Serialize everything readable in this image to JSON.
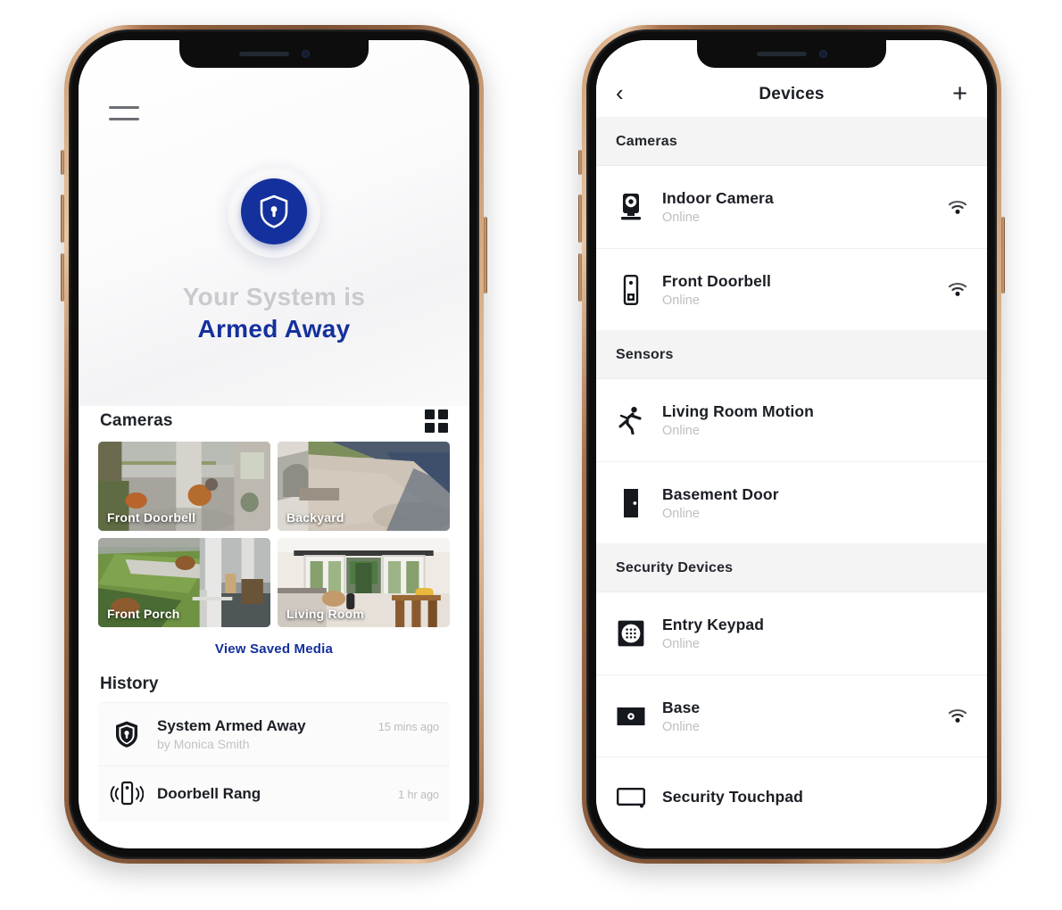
{
  "brand": {
    "accent": "#14309c",
    "muted": "#c9cacd",
    "dark": "#1b1e24"
  },
  "home": {
    "menu_icon": "hamburger-icon",
    "shield_icon": "shield-lock-icon",
    "status_prefix": "Your System is",
    "status_value": "Armed Away",
    "cameras": {
      "heading": "Cameras",
      "grid_icon": "grid-view-icon",
      "tiles": [
        {
          "label": "Front Doorbell"
        },
        {
          "label": "Backyard"
        },
        {
          "label": "Front Porch"
        },
        {
          "label": "Living Room"
        }
      ],
      "view_media_label": "View Saved Media"
    },
    "history": {
      "heading": "History",
      "items": [
        {
          "icon": "shield-lock-icon",
          "title": "System Armed Away",
          "time": "15 mins ago",
          "subtitle": "by Monica Smith"
        },
        {
          "icon": "doorbell-ring-icon",
          "title": "Doorbell Rang",
          "time": "1 hr ago",
          "subtitle": ""
        }
      ]
    }
  },
  "devices": {
    "back_icon": "chevron-left-icon",
    "title": "Devices",
    "add_icon": "plus-icon",
    "sections": [
      {
        "heading": "Cameras",
        "rows": [
          {
            "icon": "indoor-camera-icon",
            "name": "Indoor Camera",
            "status": "Online",
            "wifi": true
          },
          {
            "icon": "doorbell-icon",
            "name": "Front Doorbell",
            "status": "Online",
            "wifi": true
          }
        ]
      },
      {
        "heading": "Sensors",
        "rows": [
          {
            "icon": "motion-sensor-icon",
            "name": "Living Room Motion",
            "status": "Online",
            "wifi": false
          },
          {
            "icon": "door-sensor-icon",
            "name": "Basement Door",
            "status": "Online",
            "wifi": false
          }
        ]
      },
      {
        "heading": "Security Devices",
        "rows": [
          {
            "icon": "keypad-icon",
            "name": "Entry Keypad",
            "status": "Online",
            "wifi": false
          },
          {
            "icon": "base-station-icon",
            "name": "Base",
            "status": "Online",
            "wifi": true
          },
          {
            "icon": "touchpad-icon",
            "name": "Security Touchpad",
            "status": "",
            "wifi": false
          }
        ]
      }
    ]
  }
}
